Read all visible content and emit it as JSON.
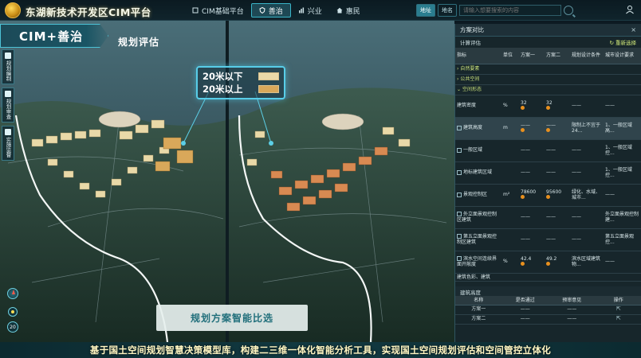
{
  "app": {
    "title": "东湖新技术开发区CIM平台"
  },
  "nav": {
    "items": [
      {
        "label": "CIM基础平台",
        "active": false,
        "icon": "cube-icon"
      },
      {
        "label": "善治",
        "active": true,
        "icon": "shield-icon"
      },
      {
        "label": "兴业",
        "active": false,
        "icon": "chart-icon"
      },
      {
        "label": "惠民",
        "active": false,
        "icon": "home-icon"
      }
    ]
  },
  "search": {
    "mode_a": "地址",
    "mode_b": "地名",
    "placeholder": "请输入想要搜索的内容"
  },
  "banner": {
    "title": "CIM+善治",
    "subtitle": "规划评估"
  },
  "side_tabs": [
    {
      "label": "规划编制"
    },
    {
      "label": "规划审查"
    },
    {
      "label": "实施监督"
    }
  ],
  "legend": {
    "items": [
      {
        "label": "20米以下",
        "color": "#e9d9a8"
      },
      {
        "label": "20米以上",
        "color": "#d9a85a"
      }
    ]
  },
  "scene": {
    "smart_label": "规划方案智能比选",
    "zoom_value": "20"
  },
  "caption": "基于国土空间规划智慧决策模型库，构建二三维一体化智能分析工具，实现国土空间规划评估和空间管控立体化",
  "panel": {
    "title": "方案对比",
    "close": "×",
    "calc_label": "计算评估",
    "reselect": "重新选择",
    "columns": [
      "指标",
      "单位",
      "方案一",
      "方案二",
      "规划设计条件",
      "城市设计要求"
    ],
    "groups": [
      {
        "label": "自然要素"
      },
      {
        "label": "公共空间"
      },
      {
        "label": "空间形态"
      }
    ],
    "rows": [
      {
        "name": "建筑密度",
        "unit": "%",
        "plan1": "32",
        "plan2": "32",
        "cond": "——",
        "req": "——"
      },
      {
        "name": "建筑高度",
        "unit": "m",
        "plan1": "——",
        "plan2": "——",
        "cond": "限制上不宜于24...",
        "req": "1、一般区域高..."
      },
      {
        "name": "一般区域",
        "unit": "",
        "plan1": "——",
        "plan2": "——",
        "cond": "——",
        "req": "1、一般区域控..."
      },
      {
        "name": "地标建筑区域",
        "unit": "",
        "plan1": "——",
        "plan2": "——",
        "cond": "——",
        "req": "1、一般区域控..."
      },
      {
        "name": "景观控制区",
        "unit": "m²",
        "plan1": "78600",
        "plan2": "95600",
        "cond": "绿化、水域、城市...",
        "req": "——"
      },
      {
        "name": "外立面景观控制区建筑",
        "unit": "",
        "plan1": "——",
        "plan2": "——",
        "cond": "——",
        "req": "外立面景观控制建..."
      },
      {
        "name": "第五立面景观控制区建筑",
        "unit": "",
        "plan1": "——",
        "plan2": "——",
        "cond": "——",
        "req": "第五立面景观控..."
      },
      {
        "name": "滨水空间连续界面开敞度",
        "unit": "%",
        "plan1": "42.4",
        "plan2": "49.2",
        "cond": "滨水区域建筑物...",
        "req": "——"
      },
      {
        "name": "建筑色彩、建筑",
        "unit": "",
        "plan1": "",
        "plan2": "",
        "cond": "",
        "req": ""
      }
    ],
    "section2_title": "建筑高度",
    "section2_columns": [
      "名称",
      "是否通过",
      "预审意见",
      "操作"
    ],
    "section2_rows": [
      {
        "name": "方案一",
        "pass": "——",
        "opinion": "——"
      },
      {
        "name": "方案二",
        "pass": "——",
        "opinion": "——"
      }
    ]
  }
}
